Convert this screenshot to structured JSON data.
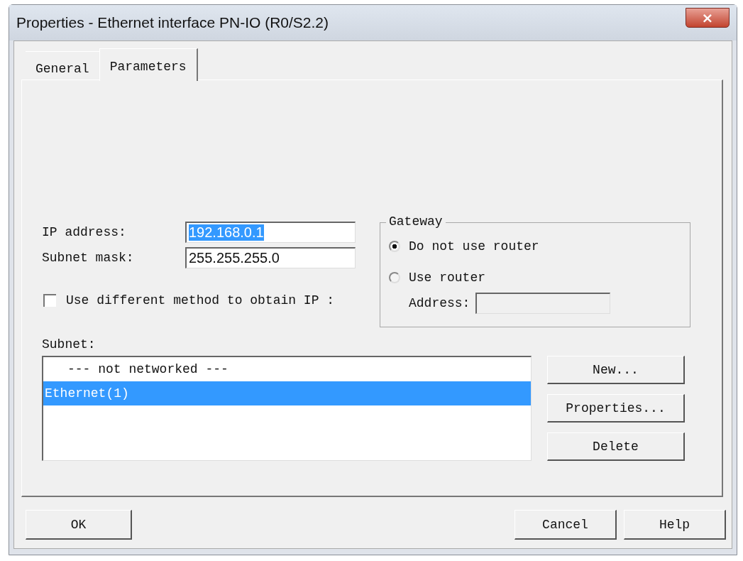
{
  "window": {
    "title": "Properties - Ethernet interface  PN-IO (R0/S2.2)",
    "close": "×"
  },
  "tabs": [
    {
      "label": "General",
      "selected": false
    },
    {
      "label": "Parameters",
      "selected": true
    }
  ],
  "fields": [
    {
      "label": "IP address:",
      "value": "192.168.0.1",
      "text_selected": true
    },
    {
      "label": "Subnet mask:",
      "value": "255.255.255.0",
      "text_selected": false
    }
  ],
  "obtain_ip": {
    "label": "Use different method to obtain IP :",
    "checked": false
  },
  "gateway": {
    "title": "Gateway",
    "options": [
      {
        "label": "Do not use router",
        "selected": true
      },
      {
        "label": "Use router",
        "selected": false
      }
    ],
    "address": {
      "label": "Address:",
      "disabled": true
    }
  },
  "subnet": {
    "label": "Subnet:",
    "items": [
      {
        "label": "--- not networked ---",
        "selected": false,
        "indent": true
      },
      {
        "label": "Ethernet(1)",
        "selected": true,
        "indent": false
      }
    ],
    "buttons": [
      "New...",
      "Properties...",
      "Delete"
    ]
  },
  "footer": {
    "left_buttons": [
      "OK"
    ],
    "right_buttons": [
      "Cancel",
      "Help"
    ]
  }
}
